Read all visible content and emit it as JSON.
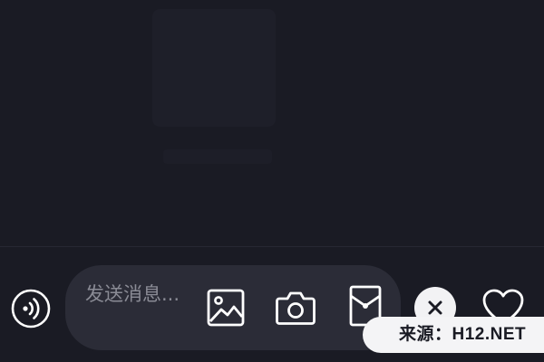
{
  "input": {
    "placeholder": "发送消息..."
  },
  "watermark": {
    "text": "来源：H12.NET"
  },
  "icons": {
    "voice": "voice-icon",
    "image": "image-icon",
    "camera": "camera-icon",
    "red_packet": "red-packet-icon",
    "close": "close-icon",
    "like": "heart-icon"
  },
  "colors": {
    "background": "#1a1b24",
    "input_bg": "#2b2c37",
    "placeholder": "#8a8b95",
    "icon": "#ffffff"
  }
}
